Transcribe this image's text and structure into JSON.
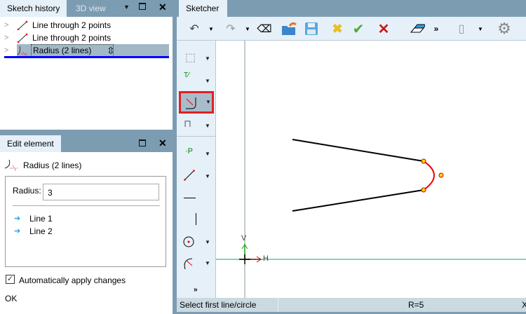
{
  "left_panel": {
    "tabs": [
      {
        "label": "Sketch history",
        "active": true
      },
      {
        "label": "3D view",
        "active": false
      }
    ],
    "tree": [
      {
        "label": "Line through 2 points",
        "icon": "line-icon"
      },
      {
        "label": "Line through 2 points",
        "icon": "line-icon"
      },
      {
        "label": "Radius (2 lines)",
        "icon": "radius-icon",
        "selected": true
      }
    ]
  },
  "edit_panel": {
    "title": "Edit element",
    "element_name": "Radius (2 lines)",
    "radius_label": "Radius:",
    "radius_value": "3",
    "refs": [
      "Line 1",
      "Line 2"
    ],
    "auto_apply_label": "Automatically apply changes",
    "auto_apply_checked": true,
    "ok_label": "OK"
  },
  "sketcher": {
    "tab": "Sketcher",
    "axis_v": "V",
    "axis_h": "H",
    "status_left": "Select first line/circle",
    "status_mid": "R=5",
    "status_right": "X"
  },
  "colors": {
    "accent": "#0000ff",
    "highlight": "#e02020",
    "panel": "#7c9cb2"
  }
}
